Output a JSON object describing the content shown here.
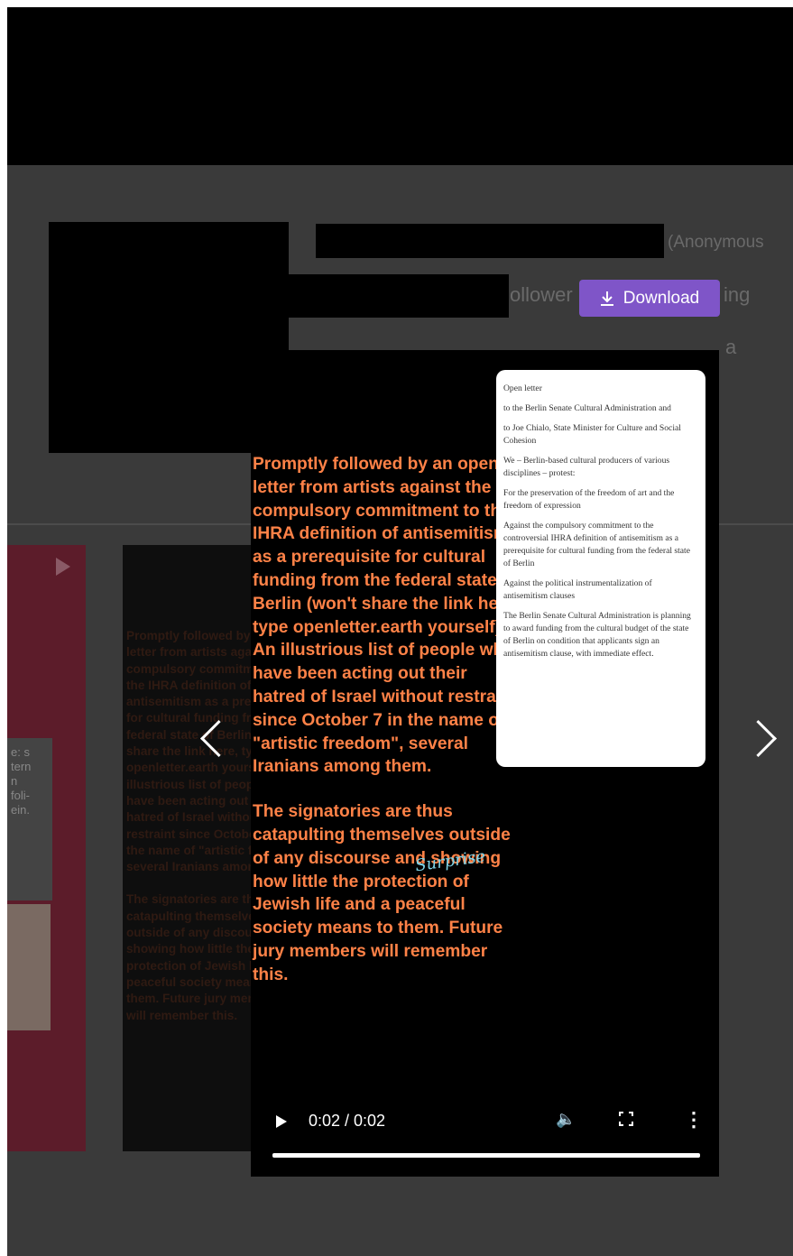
{
  "header": {
    "anonymous_label": "(Anonymous",
    "followers_fragment": "ollower",
    "following_fragment": "ing",
    "trailing_fragment": "a"
  },
  "download_button": {
    "label": "Download",
    "icon": "download-icon"
  },
  "thumbnail_left": {
    "text_fragment": "e: s\ntern\nn\nfoli-\nein."
  },
  "video": {
    "caption_paragraphs": [
      "Promptly followed by an open letter from artists against the compulsory commitment to the IHRA definition of antisemitism as a prerequisite for cultural funding from the federal state of Berlin (won't share the link here, type openletter.earth yourself) An illustrious list of people who have been acting out their hatred of Israel without restraint since October 7 in the name of \"artistic freedom\", several Iranians among them.",
      "The signatories are thus catapulting themselves outside of any discourse and showing how little the protection of Jewish life and a peaceful society means to them. Future jury members will remember this."
    ],
    "signature_text": "Surprise",
    "letter_paragraphs": [
      "Open letter",
      "to the Berlin Senate Cultural Administration and",
      "to Joe Chialo, State Minister for Culture and Social Cohesion",
      "We – Berlin-based cultural producers of various disciplines – protest:",
      "For the preservation of the freedom of art and the freedom of expression",
      "Against the compulsory commitment to the controversial IHRA definition of antisemitism as a prerequisite for cultural funding from the federal state of Berlin",
      "Against the political instrumentalization of antisemitism clauses",
      "The Berlin Senate Cultural Administration is planning to award funding from the cultural budget of the state of Berlin on condition that applicants sign an antisemitism clause, with immediate effect."
    ],
    "controls": {
      "time": "0:02 / 0:02",
      "progress": 1.0,
      "play_icon": "play-icon",
      "volume_icon": "volume-icon",
      "fullscreen_icon": "fullscreen-icon",
      "more_icon": "more-options-icon"
    }
  },
  "colors": {
    "caption": "#ff8247",
    "download": "#7f55c8"
  }
}
